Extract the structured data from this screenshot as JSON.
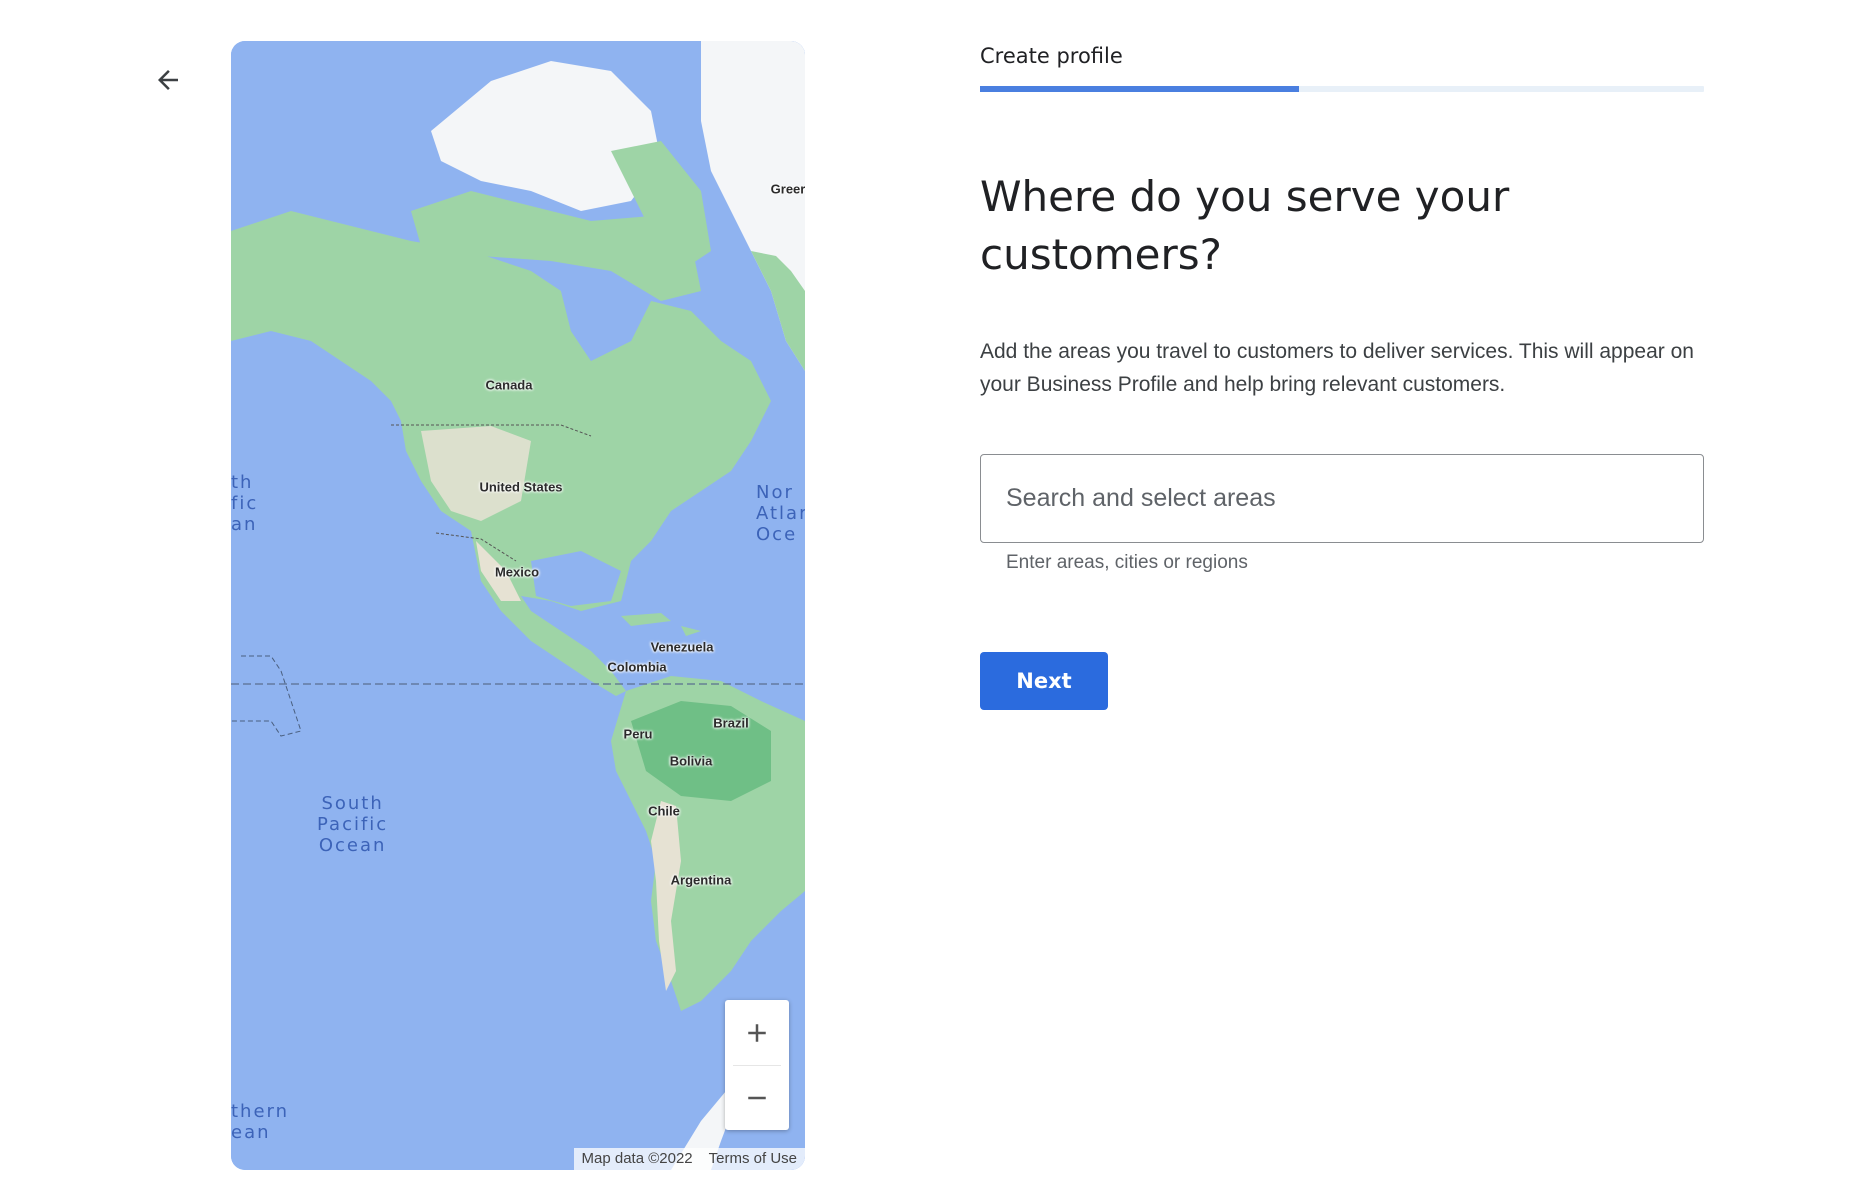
{
  "nav": {
    "back_icon": "arrow-left-icon"
  },
  "map": {
    "labels": {
      "canada": "Canada",
      "united_states": "United States",
      "mexico": "Mexico",
      "venezuela": "Venezuela",
      "colombia": "Colombia",
      "brazil": "Brazil",
      "peru": "Peru",
      "bolivia": "Bolivia",
      "chile": "Chile",
      "argentina": "Argentina",
      "greenland_partial": "Greer"
    },
    "oceans": {
      "south_pacific": "South\nPacific\nOcean",
      "north_pacific_partial": "th\nfic\nan",
      "north_atlantic_partial": "Nor\nAtlar\nOce",
      "southern_partial": "thern\nean"
    },
    "zoom_in_icon": "plus-icon",
    "zoom_out_icon": "minus-icon",
    "attribution": "Map data ©2022",
    "terms": "Terms of Use",
    "colors": {
      "water": "#8fb3f0",
      "land": "#9ed4a6",
      "land_dark": "#6fbf86",
      "ice": "#f4f6f8",
      "arid": "#e6e2d3"
    }
  },
  "form": {
    "step_label": "Create profile",
    "progress": 0.44,
    "heading": "Where do you serve your customers?",
    "description": "Add the areas you travel to customers to deliver services. This will appear on your Business Profile and help bring relevant customers.",
    "search_placeholder": "Search and select areas",
    "search_value": "",
    "helper": "Enter areas, cities or regions",
    "next_label": "Next"
  },
  "colors": {
    "accent": "#2b6bde",
    "progress": "#4a7fe0",
    "track": "#e8f0f8"
  }
}
